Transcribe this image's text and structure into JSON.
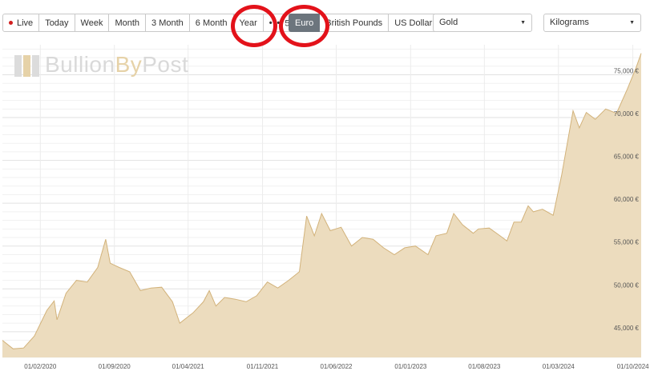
{
  "toolbar": {
    "range_buttons": [
      {
        "label": "Live",
        "active": false
      },
      {
        "label": "Today",
        "active": false
      },
      {
        "label": "Week",
        "active": false
      },
      {
        "label": "Month",
        "active": false
      },
      {
        "label": "3 Month",
        "active": false
      },
      {
        "label": "6 Month",
        "active": false
      },
      {
        "label": "Year",
        "active": false
      },
      {
        "label": "5Y",
        "active": false
      }
    ],
    "currency_buttons": [
      {
        "label": "Euro",
        "active": true
      },
      {
        "label": "British Pounds",
        "active": false
      },
      {
        "label": "US Dollar",
        "active": false
      }
    ],
    "metal_select": "Gold",
    "unit_select": "Kilograms"
  },
  "logo": {
    "text_1": "Bullion",
    "text_2": "By",
    "text_3": "Post"
  },
  "colors": {
    "fill": "#ecdcbe",
    "line": "#d2b27a",
    "annotation": "#e3121a",
    "active": "#6c757d"
  },
  "chart_data": {
    "type": "area",
    "x_tick_labels": [
      "01/02/2020",
      "01/09/2020",
      "01/04/2021",
      "01/11/2021",
      "01/06/2022",
      "01/01/2023",
      "01/08/2023",
      "01/03/2024",
      "01/10/2024"
    ],
    "y_tick_labels": [
      "45,000 €",
      "50,000 €",
      "55,000 €",
      "60,000 €",
      "65,000 €",
      "70,000 €",
      "75,000 €"
    ],
    "y_ticks": [
      45000,
      50000,
      55000,
      60000,
      65000,
      70000,
      75000
    ],
    "ylim": [
      42000,
      78500
    ],
    "x_range": [
      "2019-10-15",
      "2024-10-25"
    ],
    "grid": true,
    "series": [
      {
        "points": [
          [
            "2019-10-15",
            44000
          ],
          [
            "2019-11-15",
            43000
          ],
          [
            "2019-12-15",
            43100
          ],
          [
            "2020-01-15",
            44500
          ],
          [
            "2020-02-20",
            47500
          ],
          [
            "2020-03-12",
            48600
          ],
          [
            "2020-03-20",
            46400
          ],
          [
            "2020-04-15",
            49500
          ],
          [
            "2020-05-15",
            51000
          ],
          [
            "2020-06-15",
            50800
          ],
          [
            "2020-07-15",
            52500
          ],
          [
            "2020-08-07",
            55800
          ],
          [
            "2020-08-20",
            53000
          ],
          [
            "2020-09-15",
            52500
          ],
          [
            "2020-10-15",
            52000
          ],
          [
            "2020-11-15",
            49800
          ],
          [
            "2020-12-15",
            50100
          ],
          [
            "2021-01-15",
            50200
          ],
          [
            "2021-02-15",
            48500
          ],
          [
            "2021-03-08",
            46000
          ],
          [
            "2021-04-15",
            47200
          ],
          [
            "2021-05-15",
            48500
          ],
          [
            "2021-06-01",
            49800
          ],
          [
            "2021-06-20",
            48000
          ],
          [
            "2021-07-15",
            49000
          ],
          [
            "2021-08-15",
            48800
          ],
          [
            "2021-09-15",
            48500
          ],
          [
            "2021-10-15",
            49200
          ],
          [
            "2021-11-15",
            50800
          ],
          [
            "2021-12-15",
            50100
          ],
          [
            "2022-01-15",
            51000
          ],
          [
            "2022-02-15",
            52000
          ],
          [
            "2022-03-08",
            58500
          ],
          [
            "2022-03-30",
            56200
          ],
          [
            "2022-04-20",
            58800
          ],
          [
            "2022-05-15",
            56800
          ],
          [
            "2022-06-15",
            57200
          ],
          [
            "2022-07-15",
            55000
          ],
          [
            "2022-08-15",
            56000
          ],
          [
            "2022-09-15",
            55800
          ],
          [
            "2022-10-15",
            54800
          ],
          [
            "2022-11-15",
            54000
          ],
          [
            "2022-12-15",
            54800
          ],
          [
            "2023-01-15",
            55000
          ],
          [
            "2023-02-20",
            54000
          ],
          [
            "2023-03-15",
            56200
          ],
          [
            "2023-04-15",
            56500
          ],
          [
            "2023-05-05",
            58800
          ],
          [
            "2023-05-30",
            57500
          ],
          [
            "2023-06-30",
            56500
          ],
          [
            "2023-07-15",
            57000
          ],
          [
            "2023-08-15",
            57100
          ],
          [
            "2023-09-15",
            56200
          ],
          [
            "2023-10-05",
            55600
          ],
          [
            "2023-10-25",
            57800
          ],
          [
            "2023-11-15",
            57800
          ],
          [
            "2023-12-05",
            59700
          ],
          [
            "2023-12-20",
            59000
          ],
          [
            "2024-01-15",
            59300
          ],
          [
            "2024-02-15",
            58600
          ],
          [
            "2024-03-10",
            63200
          ],
          [
            "2024-04-12",
            70800
          ],
          [
            "2024-04-30",
            68800
          ],
          [
            "2024-05-20",
            70600
          ],
          [
            "2024-06-15",
            69800
          ],
          [
            "2024-07-15",
            71000
          ],
          [
            "2024-08-15",
            70500
          ],
          [
            "2024-09-15",
            73300
          ],
          [
            "2024-10-10",
            75800
          ],
          [
            "2024-10-25",
            77500
          ]
        ]
      }
    ]
  }
}
